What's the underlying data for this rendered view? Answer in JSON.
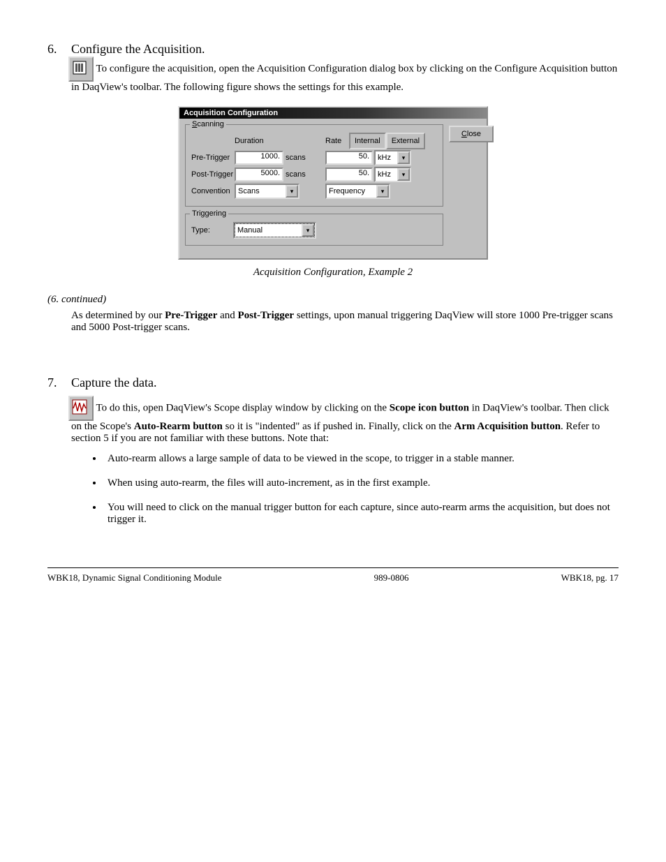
{
  "step6": {
    "num": "6.",
    "title": "Configure the Acquisition.",
    "body": "To configure the acquisition, open the Acquisition Configuration dialog box by clicking on the Configure Acquisition button in DaqView's toolbar.  The following figure shows the settings for this example.",
    "icon": "acquisition-config-icon"
  },
  "dialog": {
    "title": "Acquisition Configuration",
    "close": "Close",
    "close_u": "C",
    "scanning": {
      "legend": "Scanning",
      "legend_u": "S",
      "duration_hdr": "Duration",
      "rate_hdr": "Rate",
      "internal": "Internal",
      "external": "External",
      "pre_label": "Pre-Trigger",
      "pre_val": "1000.",
      "pre_unit": "scans",
      "pre_rate": "50.",
      "pre_rate_unit": "kHz",
      "post_label": "Post-Trigger",
      "post_val": "5000.",
      "post_unit": "scans",
      "post_rate": "50.",
      "post_rate_unit": "kHz",
      "conv_label": "Convention",
      "conv_val": "Scans",
      "conv_rate": "Frequency"
    },
    "triggering": {
      "legend": "Triggering",
      "type_label": "Type:",
      "type_val": "Manual"
    }
  },
  "caption": "Acquisition Configuration, Example 2",
  "step6b": {
    "a": "As determined by our ",
    "b": "Pre-Trigger",
    "c": " and ",
    "d": "Post-Trigger",
    "e": " settings, upon manual triggering DaqView will store 1000 Pre-trigger scans and 5000 Post-trigger scans."
  },
  "step7": {
    "num": "7.",
    "title": "Capture the data.",
    "icon": "scope-icon",
    "a": "To do this, open DaqView's Scope display window by clicking on the ",
    "b": "Scope icon button",
    "c": " in DaqView's toolbar.  Then click on the Scope's ",
    "d": "Auto-Rearm button",
    "e": " so it is \"indented\" as if pushed in.  Finally, click on the ",
    "f": "Arm Acquisition button",
    "g": ".  Refer to section 5 if you are not familiar with these buttons.  Note that:"
  },
  "bullets": [
    "Auto-rearm allows a large sample of data to be viewed in the scope, to trigger in a stable manner.",
    "When using auto-rearm, the files will auto-increment, as in the first example.",
    "You will need to click on the manual trigger button for each capture, since auto-rearm arms the acquisition, but does not trigger it."
  ],
  "footer": {
    "left": "WBK18, Dynamic Signal Conditioning Module",
    "mid": "989-0806",
    "right": "WBK18, pg. 17"
  }
}
